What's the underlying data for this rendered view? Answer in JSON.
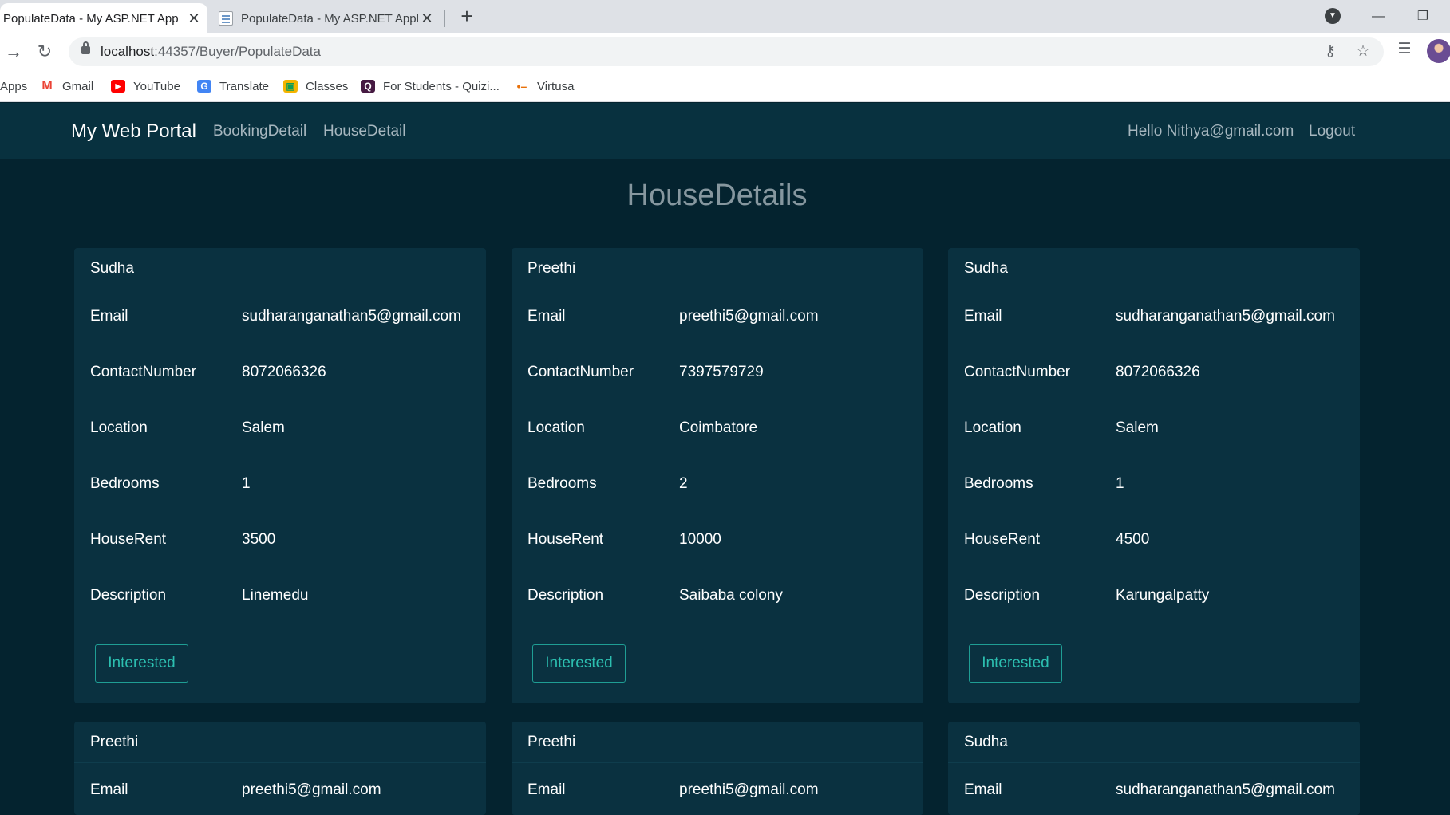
{
  "browser": {
    "tabs": [
      {
        "title": "PopulateData - My ASP.NET Appl",
        "active": true
      },
      {
        "title": "PopulateData - My ASP.NET Appl",
        "active": false
      }
    ],
    "new_tab_symbol": "+",
    "url_host": "localhost",
    "url_path": ":44357/Buyer/PopulateData",
    "bookmarks": [
      {
        "label": "Apps",
        "icon": "apps-icon"
      },
      {
        "label": "Gmail",
        "icon": "gmail-icon"
      },
      {
        "label": "YouTube",
        "icon": "youtube-icon"
      },
      {
        "label": "Translate",
        "icon": "translate-icon"
      },
      {
        "label": "Classes",
        "icon": "classes-icon"
      },
      {
        "label": "For Students - Quizi...",
        "icon": "quizizz-icon"
      },
      {
        "label": "Virtusa",
        "icon": "virtusa-icon"
      }
    ]
  },
  "site": {
    "brand": "My Web Portal",
    "nav": [
      "BookingDetail",
      "HouseDetail"
    ],
    "greeting": "Hello Nithya@gmail.com",
    "logout": "Logout",
    "page_title": "HouseDetails",
    "field_labels": {
      "email": "Email",
      "contact": "ContactNumber",
      "location": "Location",
      "bedrooms": "Bedrooms",
      "rent": "HouseRent",
      "description": "Description"
    },
    "button_label": "Interested",
    "cards": [
      {
        "name": "Sudha",
        "email": "sudharanganathan5@gmail.com",
        "contact": "8072066326",
        "location": "Salem",
        "bedrooms": "1",
        "rent": "3500",
        "description": "Linemedu"
      },
      {
        "name": "Preethi",
        "email": "preethi5@gmail.com",
        "contact": "7397579729",
        "location": "Coimbatore",
        "bedrooms": "2",
        "rent": "10000",
        "description": "Saibaba colony"
      },
      {
        "name": "Sudha",
        "email": "sudharanganathan5@gmail.com",
        "contact": "8072066326",
        "location": "Salem",
        "bedrooms": "1",
        "rent": "4500",
        "description": "Karungalpatty"
      },
      {
        "name": "Preethi",
        "email": "preethi5@gmail.com"
      },
      {
        "name": "Preethi",
        "email": "preethi5@gmail.com"
      },
      {
        "name": "Sudha",
        "email": "sudharanganathan5@gmail.com"
      }
    ]
  },
  "colors": {
    "page_bg": "#04232f",
    "navbar_bg": "#08313f",
    "card_bg": "#0a3140",
    "accent": "#2cbfb0"
  }
}
